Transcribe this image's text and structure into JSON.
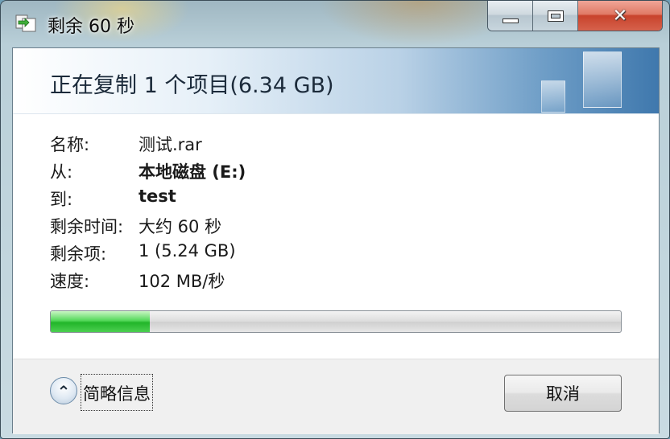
{
  "window": {
    "title": "剩余 60 秒",
    "close_glyph": "✕"
  },
  "header": {
    "title": "正在复制 1 个项目(6.34 GB)"
  },
  "details": [
    {
      "label": "名称:",
      "value": "测试.rar",
      "bold": false
    },
    {
      "label": "从:",
      "value": "本地磁盘 (E:)",
      "bold": true
    },
    {
      "label": "到:",
      "value": "test",
      "bold": true
    },
    {
      "label": "剩余时间:",
      "value": "大约 60 秒",
      "bold": false
    },
    {
      "label": "剩余项:",
      "value": "1 (5.24 GB)",
      "bold": false
    },
    {
      "label": "速度:",
      "value": "102 MB/秒",
      "bold": false
    }
  ],
  "progress": {
    "fraction": 0.174,
    "color": "#22b52a"
  },
  "footer": {
    "expander_glyph": "⌃",
    "expander_label": "简略信息",
    "cancel_label": "取消"
  },
  "icons": {
    "title_icon": "copy-icon",
    "expander_icon": "chevron-up-icon"
  }
}
